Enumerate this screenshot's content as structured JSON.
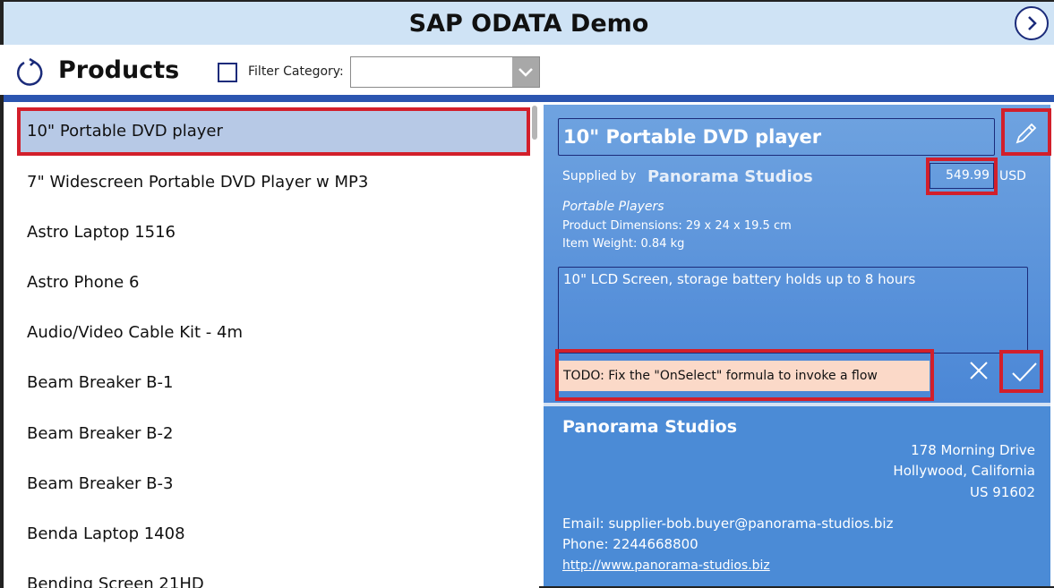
{
  "app": {
    "title": "SAP ODATA Demo"
  },
  "toolbar": {
    "page_title": "Products",
    "filter_label": "Filter Category:",
    "filter_value": ""
  },
  "products": [
    "10\" Portable DVD player",
    "7\" Widescreen Portable DVD Player w MP3",
    "Astro Laptop 1516",
    "Astro Phone 6",
    "Audio/Video Cable Kit - 4m",
    "Beam Breaker B-1",
    "Beam Breaker B-2",
    "Beam Breaker B-3",
    "Benda Laptop 1408",
    "Bending Screen 21HD"
  ],
  "detail": {
    "name": "10\" Portable DVD player",
    "supplied_label": "Supplied by",
    "supplier": "Panorama Studios",
    "price": "549.99",
    "currency": "USD",
    "category": "Portable Players",
    "dimensions": "Product Dimensions: 29 x 24 x 19.5 cm",
    "weight": "Item Weight: 0.84 kg",
    "description": "10\" LCD Screen, storage battery holds up to 8 hours",
    "todo": "TODO: Fix the \"OnSelect\" formula to invoke a flow"
  },
  "supplier_card": {
    "name": "Panorama Studios",
    "address_line1": "178 Morning Drive",
    "address_line2": "Hollywood, California",
    "address_line3": "US 91602",
    "email": "Email: supplier-bob.buyer@panorama-studios.biz",
    "phone": "Phone: 2244668800",
    "url": "http://www.panorama-studios.biz"
  },
  "colors": {
    "accent": "#2b55b0",
    "header_bg": "#cfe3f5",
    "highlight": "#d21f2b",
    "selected_row": "#b7c9e6"
  },
  "icons": [
    "chevron-right-icon",
    "refresh-icon",
    "chevron-down-icon",
    "pencil-icon",
    "close-icon",
    "checkmark-icon"
  ]
}
